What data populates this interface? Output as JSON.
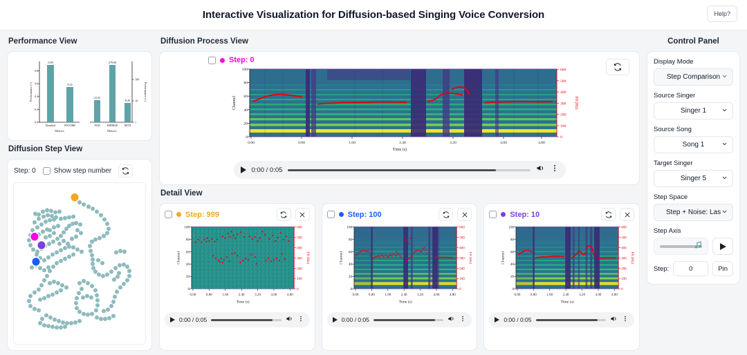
{
  "header": {
    "title": "Interactive Visualization for Diffusion-based Singing Voice Conversion",
    "help_label": "Help?"
  },
  "performance_view": {
    "title": "Performance View",
    "chart_data": {
      "type": "bar",
      "title": "",
      "panels": [
        {
          "categories": [
            "Dembed",
            "F0CORR"
          ],
          "values": [
            0.89,
            0.55
          ],
          "labels": [
            "0.89",
            "0.55"
          ],
          "xlabel": "Metrics",
          "ylabel": "Performance (↑)",
          "ylim": [
            0.0,
            0.9
          ],
          "yticks": [
            "0.0",
            "0.2",
            "0.4",
            "0.6",
            "0.8"
          ],
          "scale": "linear"
        },
        {
          "categories": [
            "FAD",
            "F0RMSE",
            "MCD"
          ],
          "values": [
            10.35,
            279.6,
            8.2
          ],
          "labels": [
            "10.35",
            "279.60",
            "8.20"
          ],
          "xlabel": "Metrics",
          "ylabel": "Performance (↓)",
          "ylim": [
            1,
            300
          ],
          "yticks": [
            "1",
            "10",
            "100"
          ],
          "scale": "log"
        }
      ],
      "bar_color": "#5fa3a8",
      "grid": false,
      "legend": "none"
    }
  },
  "diffusion_step_view": {
    "title": "Diffusion Step View",
    "step_label": "Step: 0",
    "show_step_number_label": "Show step number",
    "reload_icon": "reload-icon",
    "checkbox_checked": false,
    "scatter": {
      "type": "scatter",
      "point_color": "#6fa8ab",
      "highlights": [
        {
          "label": "Step: 999",
          "color": "#f5a623",
          "x": 0.4,
          "y": 0.07
        },
        {
          "label": "Step: 0",
          "color": "#ff00e0",
          "x": 0.118,
          "y": 0.41
        },
        {
          "label": "Step: 10",
          "color": "#7b3fe4",
          "x": 0.165,
          "y": 0.475
        },
        {
          "label": "Step: 100",
          "color": "#1a5cff",
          "x": 0.135,
          "y": 0.58
        }
      ]
    }
  },
  "diffusion_process_view": {
    "title": "Diffusion Process View",
    "step_label": "Step: 0",
    "step_color": "#ff00e0",
    "checkbox_checked": false,
    "reload_icon": "reload-icon",
    "spectrogram": {
      "ylabel": "Channel",
      "yticks": [
        "0",
        "20",
        "40",
        "60",
        "80",
        "100"
      ],
      "xlabel": "Time (s)",
      "xticks": [
        "0.00",
        "0.80",
        "1.60",
        "2.40",
        "3.20",
        "4.00",
        "4.80"
      ],
      "y2label": "F0 (Hz)",
      "y2ticks": [
        "0",
        "100",
        "200",
        "300",
        "400",
        "500",
        "600"
      ],
      "f0_color": "#e8000b"
    },
    "player": {
      "play_icon": "play-icon",
      "time": "0:00 / 0:05",
      "volume_icon": "volume-icon",
      "menu_icon": "more-vertical-icon",
      "progress_pct": 86
    }
  },
  "detail_view": {
    "title": "Detail View",
    "panels": [
      {
        "step_label": "Step: 999",
        "step_color": "#f5a623",
        "checkbox_checked": false,
        "reload_icon": "reload-icon",
        "close_icon": "close-icon",
        "noise": true,
        "spectrogram": {
          "ylabel": "Channel",
          "yticks": [
            "0",
            "20",
            "40",
            "60",
            "80",
            "100"
          ],
          "xlabel": "Time (s)",
          "xticks": [
            "0.00",
            "0.80",
            "1.60",
            "2.40",
            "3.20",
            "4.00",
            "4.80"
          ],
          "y2label": "F0 (Hz)",
          "y2ticks": [
            "0",
            "100",
            "200",
            "300",
            "400",
            "500",
            "600"
          ],
          "f0_color": "#e8000b"
        },
        "player": {
          "play_icon": "play-icon",
          "time": "0:00 / 0:05",
          "volume_icon": "volume-icon",
          "menu_icon": "more-vertical-icon",
          "progress_pct": 88
        }
      },
      {
        "step_label": "Step: 100",
        "step_color": "#1a5cff",
        "checkbox_checked": false,
        "reload_icon": "reload-icon",
        "close_icon": "close-icon",
        "noise": false,
        "spectrogram": {
          "ylabel": "Channel",
          "yticks": [
            "0",
            "20",
            "40",
            "60",
            "80",
            "100"
          ],
          "xlabel": "Time (s)",
          "xticks": [
            "0.00",
            "0.80",
            "1.60",
            "2.40",
            "3.20",
            "4.00",
            "4.80"
          ],
          "y2label": "F0 (Hz)",
          "y2ticks": [
            "0",
            "100",
            "200",
            "300",
            "400",
            "500",
            "600"
          ],
          "f0_color": "#e8000b"
        },
        "player": {
          "play_icon": "play-icon",
          "time": "0:00 / 0:05",
          "volume_icon": "volume-icon",
          "menu_icon": "more-vertical-icon",
          "progress_pct": 88
        }
      },
      {
        "step_label": "Step: 10",
        "step_color": "#7b3fe4",
        "checkbox_checked": false,
        "reload_icon": "reload-icon",
        "close_icon": "close-icon",
        "noise": false,
        "spectrogram": {
          "ylabel": "Channel",
          "yticks": [
            "0",
            "20",
            "40",
            "60",
            "80",
            "100"
          ],
          "xlabel": "Time (s)",
          "xticks": [
            "0.00",
            "0.80",
            "1.60",
            "2.40",
            "3.20",
            "4.00",
            "4.80"
          ],
          "y2label": "F0 (Hz)",
          "y2ticks": [
            "0",
            "100",
            "200",
            "300",
            "400",
            "500",
            "600"
          ],
          "f0_color": "#e8000b"
        },
        "player": {
          "play_icon": "play-icon",
          "time": "0:00 / 0:05",
          "volume_icon": "volume-icon",
          "menu_icon": "more-vertical-icon",
          "progress_pct": 88
        }
      }
    ]
  },
  "control_panel": {
    "title": "Control Panel",
    "groups": [
      {
        "label": "Display Mode",
        "value": "Step Comparison",
        "icon": "chevron-down-icon"
      },
      {
        "label": "Source Singer",
        "value": "Singer 1",
        "icon": "chevron-down-icon"
      },
      {
        "label": "Source Song",
        "value": "Song 1",
        "icon": "chevron-down-icon"
      },
      {
        "label": "Target Singer",
        "value": "Singer 5",
        "icon": "chevron-down-icon"
      },
      {
        "label": "Step Space",
        "value": "Step + Noise: Las",
        "icon": "chevron-down-icon"
      }
    ],
    "step_axis": {
      "label": "Step Axis",
      "handle_icon": "music-note-icon",
      "play_icon": "play-icon",
      "slider_value_pct": 88
    },
    "step_field": {
      "label": "Step:",
      "value": "0",
      "pin_label": "Pin"
    }
  }
}
